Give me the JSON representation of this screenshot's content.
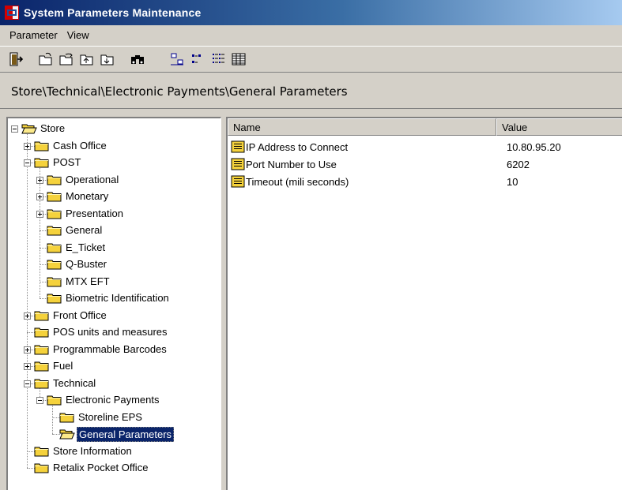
{
  "window": {
    "title": "System Parameters Maintenance"
  },
  "menu": [
    {
      "id": "parameter",
      "label": "Parameter"
    },
    {
      "id": "view",
      "label": "View"
    }
  ],
  "toolbar": {
    "buttons": [
      {
        "id": "exit",
        "icon": "exit-door-icon"
      },
      {
        "id": "open",
        "icon": "open-folder-icon"
      },
      {
        "id": "open-up",
        "icon": "folder-arrow-icon"
      },
      {
        "id": "up-level",
        "icon": "folder-up-icon"
      },
      {
        "id": "down-level",
        "icon": "folder-down-icon"
      },
      {
        "id": "find",
        "icon": "binoculars-icon"
      },
      {
        "id": "large-icons",
        "icon": "large-icons-view-icon"
      },
      {
        "id": "small-icons",
        "icon": "small-icons-view-icon"
      },
      {
        "id": "list",
        "icon": "list-view-icon"
      },
      {
        "id": "details",
        "icon": "details-view-icon"
      }
    ]
  },
  "path": "Store\\Technical\\Electronic Payments\\General Parameters",
  "tree": {
    "nodes": [
      {
        "id": "store",
        "label": "Store",
        "level": 0,
        "expander": "minus",
        "open": true
      },
      {
        "id": "cash-office",
        "label": "Cash Office",
        "level": 1,
        "expander": "plus"
      },
      {
        "id": "post",
        "label": "POST",
        "level": 1,
        "expander": "minus"
      },
      {
        "id": "operational",
        "label": "Operational",
        "level": 2,
        "expander": "plus"
      },
      {
        "id": "monetary",
        "label": "Monetary",
        "level": 2,
        "expander": "plus"
      },
      {
        "id": "presentation",
        "label": "Presentation",
        "level": 2,
        "expander": "plus"
      },
      {
        "id": "general",
        "label": "General",
        "level": 2,
        "expander": "none"
      },
      {
        "id": "e-ticket",
        "label": "E_Ticket",
        "level": 2,
        "expander": "none"
      },
      {
        "id": "q-buster",
        "label": "Q-Buster",
        "level": 2,
        "expander": "none"
      },
      {
        "id": "mtx-eft",
        "label": "MTX EFT",
        "level": 2,
        "expander": "none"
      },
      {
        "id": "biometric",
        "label": "Biometric Identification",
        "level": 2,
        "expander": "none"
      },
      {
        "id": "front-office",
        "label": "Front Office",
        "level": 1,
        "expander": "plus"
      },
      {
        "id": "pos-units",
        "label": "POS units and measures",
        "level": 1,
        "expander": "none"
      },
      {
        "id": "barcodes",
        "label": "Programmable Barcodes",
        "level": 1,
        "expander": "plus"
      },
      {
        "id": "fuel",
        "label": "Fuel",
        "level": 1,
        "expander": "plus"
      },
      {
        "id": "technical",
        "label": "Technical",
        "level": 1,
        "expander": "minus"
      },
      {
        "id": "electronic-payments",
        "label": "Electronic Payments",
        "level": 2,
        "expander": "minus"
      },
      {
        "id": "storeline-eps",
        "label": "Storeline EPS",
        "level": 3,
        "expander": "none"
      },
      {
        "id": "general-parameters",
        "label": "General Parameters",
        "level": 3,
        "expander": "none",
        "open": true,
        "selected": true
      },
      {
        "id": "store-information",
        "label": "Store Information",
        "level": 1,
        "expander": "none"
      },
      {
        "id": "pocket-office",
        "label": "Retalix Pocket Office",
        "level": 1,
        "expander": "none"
      }
    ]
  },
  "list": {
    "columns": {
      "name": "Name",
      "value": "Value"
    },
    "rows": [
      {
        "name": "IP Address to Connect",
        "value": "10.80.95.20"
      },
      {
        "name": "Port Number to Use",
        "value": "6202"
      },
      {
        "name": "Timeout (mili seconds)",
        "value": "10"
      }
    ]
  },
  "colors": {
    "titlebar_start": "#0a246a",
    "titlebar_end": "#a6caf0",
    "selection": "#0a246a",
    "folder": "#f5d23c",
    "window_bg": "#d4d0c8"
  }
}
